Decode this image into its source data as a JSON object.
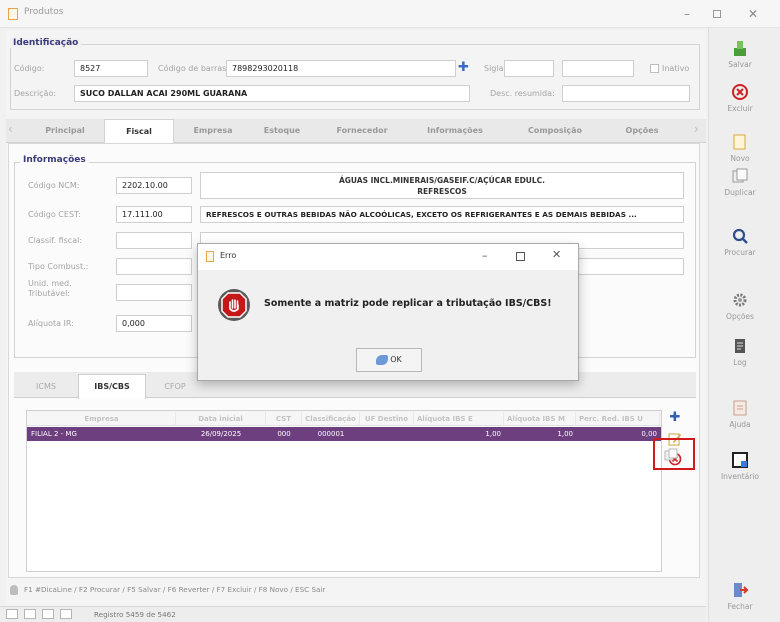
{
  "window": {
    "title": "Produtos"
  },
  "identificacao": {
    "title": "Identificação",
    "codigo_label": "Código:",
    "codigo_value": "8527",
    "barras_label": "Código de barras:",
    "barras_value": "7898293020118",
    "sigla_label": "Sigla:",
    "inativo_label": "Inativo",
    "descricao_label": "Descrição:",
    "descricao_value": "SUCO DALLAN ACAI 290ML GUARANA",
    "desc_resumida_label": "Desc. resumida:"
  },
  "tabs": [
    "Principal",
    "Fiscal",
    "Empresa",
    "Estoque",
    "Fornecedor",
    "Informações",
    "Composição",
    "Opções"
  ],
  "informacoes": {
    "title": "Informações",
    "ncm_label": "Código NCM:",
    "ncm_value": "2202.10.00",
    "ncm_desc_line1": "ÁGUAS INCL.MINERAIS/GASEIF.C/AÇÚCAR EDULC.",
    "ncm_desc_line2": "REFRESCOS",
    "cest_label": "Código CEST:",
    "cest_value": "17.111.00",
    "cest_desc": "REFRESCOS E OUTRAS BEBIDAS NÃO ALCOÓLICAS, EXCETO OS REFRIGERANTES E AS DEMAIS BEBIDAS ...",
    "classif_label": "Classif. fiscal:",
    "combust_label": "Tipo Combust.:",
    "unid_label_1": "Unid. med.",
    "unid_label_2": "Tributável:",
    "aliquota_label": "Alíquota IR:",
    "aliquota_value": "0,000"
  },
  "subtabs": [
    "ICMS",
    "IBS/CBS",
    "CFOP"
  ],
  "grid": {
    "columns": [
      "Empresa",
      "Data inicial",
      "CST",
      "Classificação",
      "UF Destino",
      "Alíquota IBS E",
      "Alíquota IBS M",
      "Perc. Red. IBS U"
    ],
    "rows": [
      {
        "empresa": "FILIAL 2 - MG",
        "data": "26/09/2025",
        "cst": "000",
        "classif": "000001",
        "uf": "",
        "aliq_e": "1,00",
        "aliq_m": "1,00",
        "perc": "0,00"
      }
    ]
  },
  "sidebar": [
    "Salvar",
    "Excluir",
    "Novo",
    "Duplicar",
    "Procurar",
    "Opções",
    "Log",
    "Ajuda",
    "Inventário",
    "Fechar"
  ],
  "dialog": {
    "title": "Erro",
    "message": "Somente a matriz pode replicar a tributação IBS/CBS!",
    "ok": "OK"
  },
  "statusbar": {
    "shortcuts": "F1 #DicaLine / F2 Procurar / F5 Salvar / F6 Reverter / F7 Excluir / F8 Novo / ESC Sair",
    "registro": "Registro 5459 de 5462"
  },
  "colors": {
    "selected_row": "#6d3f7f",
    "stop_red": "#c41717",
    "header_blue": "#3b3b7a",
    "highlight": "#d21a1a"
  }
}
